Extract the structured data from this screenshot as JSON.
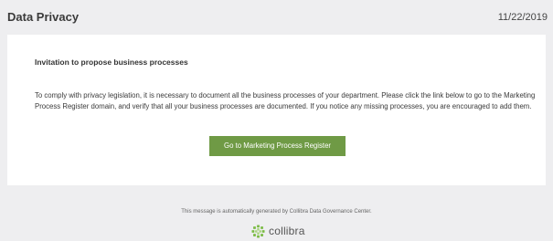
{
  "header": {
    "title": "Data Privacy",
    "date": "11/22/2019"
  },
  "message": {
    "heading": "Invitation to propose business processes",
    "body": "To comply with privacy legislation, it is necessary to document all the business processes of your department. Please click the link below to go to the Marketing Process Register domain, and verify that all your business processes are documented. If you notice any missing processes, you are encouraged to add them.",
    "button_label": "Go to Marketing Process Register"
  },
  "footer": {
    "note": "This message is automatically generated by Collibra Data Governance Center.",
    "logo_text": "collibra"
  },
  "colors": {
    "page_background": "#eeeef0",
    "button": "#6f9a45",
    "logo_green": "#7bbb45"
  },
  "icons": {
    "logo": "collibra-logo-icon"
  }
}
